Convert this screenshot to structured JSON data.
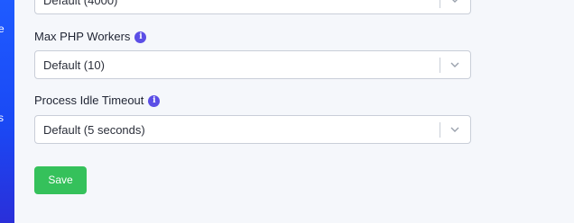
{
  "sidebar": {
    "items": [
      {
        "label": "e"
      },
      {
        "label": "s"
      }
    ]
  },
  "form": {
    "fields": [
      {
        "label": "",
        "value": "Default (4000)"
      },
      {
        "label": "Max PHP Workers",
        "value": "Default (10)"
      },
      {
        "label": "Process Idle Timeout",
        "value": "Default (5 seconds)"
      }
    ],
    "save_label": "Save"
  },
  "colors": {
    "sidebar": "#1f5bff",
    "accent_button": "#35c15b",
    "info_icon": "#5b4ee6",
    "background": "#f5f7fb"
  },
  "icons": {
    "info": "info-icon",
    "dropdown": "chevron-down-icon"
  }
}
